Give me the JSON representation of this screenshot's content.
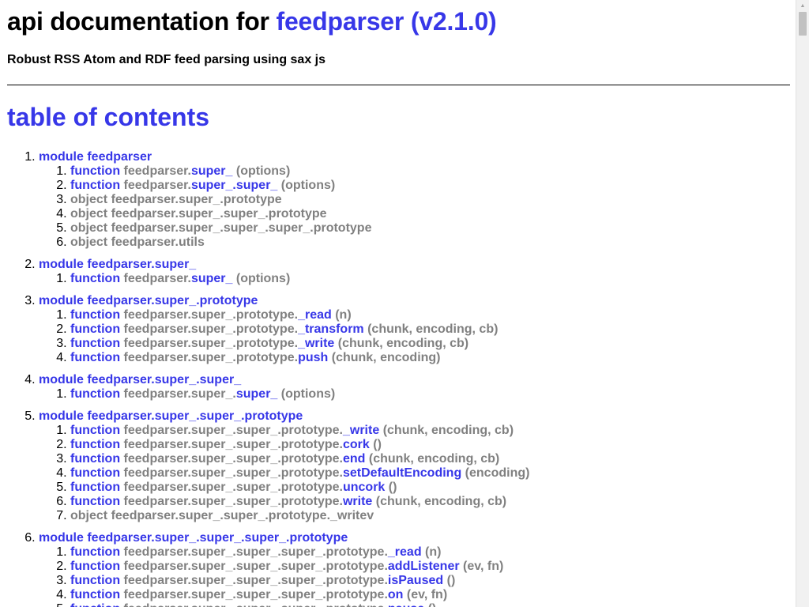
{
  "header": {
    "title_prefix": "api documentation for ",
    "package_link": "feedparser (v2.1.0)",
    "subtitle": "Robust RSS Atom and RDF feed parsing using sax js"
  },
  "toc": {
    "title": "table of contents",
    "modules": [
      {
        "label": "module feedparser",
        "members": [
          {
            "kind": "function",
            "path": "feedparser.",
            "name": "super_",
            "args": "(options)"
          },
          {
            "kind": "function",
            "path": "feedparser.",
            "name": "super_.super_",
            "args": "(options)"
          },
          {
            "kind": "object",
            "path": "feedparser.super_.prototype",
            "name": "",
            "args": ""
          },
          {
            "kind": "object",
            "path": "feedparser.super_.super_.prototype",
            "name": "",
            "args": ""
          },
          {
            "kind": "object",
            "path": "feedparser.super_.super_.super_.prototype",
            "name": "",
            "args": ""
          },
          {
            "kind": "object",
            "path": "feedparser.utils",
            "name": "",
            "args": ""
          }
        ]
      },
      {
        "label": "module feedparser.super_",
        "members": [
          {
            "kind": "function",
            "path": "feedparser.",
            "name": "super_",
            "args": "(options)"
          }
        ]
      },
      {
        "label": "module feedparser.super_.prototype",
        "members": [
          {
            "kind": "function",
            "path": "feedparser.super_.prototype.",
            "name": "_read",
            "args": "(n)"
          },
          {
            "kind": "function",
            "path": "feedparser.super_.prototype.",
            "name": "_transform",
            "args": "(chunk, encoding, cb)"
          },
          {
            "kind": "function",
            "path": "feedparser.super_.prototype.",
            "name": "_write",
            "args": "(chunk, encoding, cb)"
          },
          {
            "kind": "function",
            "path": "feedparser.super_.prototype.",
            "name": "push",
            "args": "(chunk, encoding)"
          }
        ]
      },
      {
        "label": "module feedparser.super_.super_",
        "members": [
          {
            "kind": "function",
            "path": "feedparser.super_.",
            "name": "super_",
            "args": "(options)"
          }
        ]
      },
      {
        "label": "module feedparser.super_.super_.prototype",
        "members": [
          {
            "kind": "function",
            "path": "feedparser.super_.super_.prototype.",
            "name": "_write",
            "args": "(chunk, encoding, cb)"
          },
          {
            "kind": "function",
            "path": "feedparser.super_.super_.prototype.",
            "name": "cork",
            "args": "()"
          },
          {
            "kind": "function",
            "path": "feedparser.super_.super_.prototype.",
            "name": "end",
            "args": "(chunk, encoding, cb)"
          },
          {
            "kind": "function",
            "path": "feedparser.super_.super_.prototype.",
            "name": "setDefaultEncoding",
            "args": "(encoding)"
          },
          {
            "kind": "function",
            "path": "feedparser.super_.super_.prototype.",
            "name": "uncork",
            "args": "()"
          },
          {
            "kind": "function",
            "path": "feedparser.super_.super_.prototype.",
            "name": "write",
            "args": "(chunk, encoding, cb)"
          },
          {
            "kind": "object",
            "path": "feedparser.super_.super_.prototype._writev",
            "name": "",
            "args": ""
          }
        ]
      },
      {
        "label": "module feedparser.super_.super_.super_.prototype",
        "members": [
          {
            "kind": "function",
            "path": "feedparser.super_.super_.super_.prototype.",
            "name": "_read",
            "args": "(n)"
          },
          {
            "kind": "function",
            "path": "feedparser.super_.super_.super_.prototype.",
            "name": "addListener",
            "args": "(ev, fn)"
          },
          {
            "kind": "function",
            "path": "feedparser.super_.super_.super_.prototype.",
            "name": "isPaused",
            "args": "()"
          },
          {
            "kind": "function",
            "path": "feedparser.super_.super_.super_.prototype.",
            "name": "on",
            "args": "(ev, fn)"
          },
          {
            "kind": "function",
            "path": "feedparser.super_.super_.super_.prototype.",
            "name": "pause",
            "args": "()"
          }
        ]
      }
    ]
  },
  "scrollbar": {
    "up_icon": "triangle-up"
  }
}
